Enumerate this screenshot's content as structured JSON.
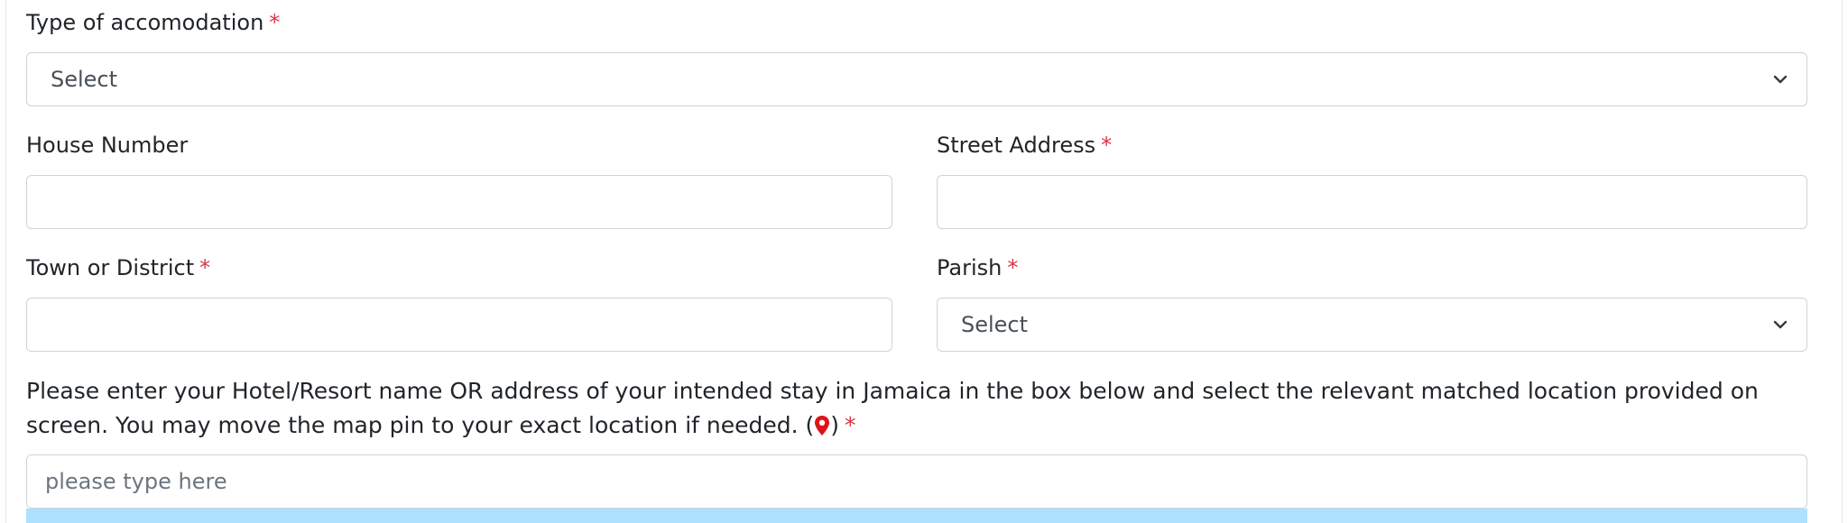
{
  "form": {
    "accommodation": {
      "label": "Type of accomodation",
      "required_mark": "*",
      "selected": "Select"
    },
    "house_number": {
      "label": "House Number",
      "value": ""
    },
    "street_address": {
      "label": "Street Address",
      "required_mark": "*",
      "value": ""
    },
    "town": {
      "label": "Town or District",
      "required_mark": "*",
      "value": ""
    },
    "parish": {
      "label": "Parish",
      "required_mark": "*",
      "selected": "Select"
    },
    "location": {
      "instructions": "Please enter your Hotel/Resort name OR address of your intended stay in Jamaica in the box below and select the relevant matched location provided on screen. You may move the map pin to your exact location if needed.",
      "paren_open": "(",
      "paren_close": ")",
      "required_mark": "*",
      "placeholder": "please type here",
      "pin_icon": "map-pin-icon"
    }
  },
  "colors": {
    "required": "#dc3545",
    "pin": "#e0131a",
    "suggestion_highlight": "#aee0ff",
    "border": "#ced4da"
  }
}
